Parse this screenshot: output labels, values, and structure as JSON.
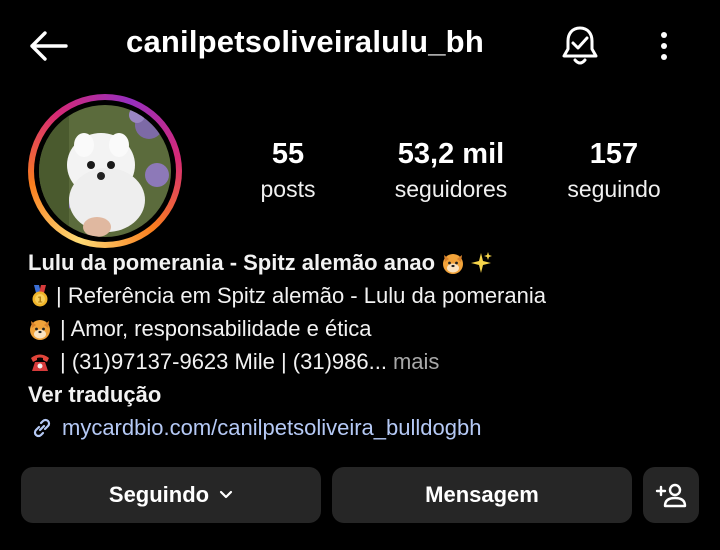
{
  "header": {
    "username": "canilpetsoliveiralulu_bh",
    "back_icon": "arrow-left-icon",
    "notify_icon": "bell-check-icon",
    "more_icon": "vertical-dots-icon"
  },
  "stats": [
    {
      "value": "55",
      "label": "posts"
    },
    {
      "value": "53,2 mil",
      "label": "seguidores"
    },
    {
      "value": "157",
      "label": "seguindo"
    }
  ],
  "bio": {
    "name": "Lulu da pomerania - Spitz alemão anao",
    "line1": "| Referência em Spitz alemão - Lulu da pomerania",
    "line2": "| Amor, responsabilidade e ética",
    "line3": "| (31)97137-9623 Mile | (31)986...",
    "more_label": "mais",
    "translate_label": "Ver tradução",
    "link": "mycardbio.com/canilpetsoliveira_bulldogbh"
  },
  "actions": {
    "following_label": "Seguindo",
    "message_label": "Mensagem"
  },
  "colors": {
    "background": "#000000",
    "button_bg": "#262626",
    "link": "#b5c9f5",
    "muted": "#a8a8a8"
  }
}
